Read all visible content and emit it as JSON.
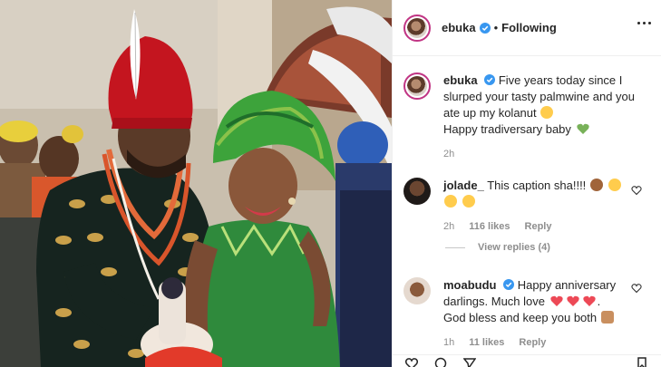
{
  "post": {
    "username": "ebuka",
    "follow_separator": "•",
    "follow_status": "Following"
  },
  "caption": {
    "username": "ebuka",
    "text_line1": "Five years today since I slurped your tasty palmwine and you ate up my kolanut",
    "text_line2": "Happy tradiversary baby",
    "time": "2h"
  },
  "comments": [
    {
      "username": "jolade_",
      "text": "This caption sha!!!!",
      "likes": "116 likes",
      "reply": "Reply",
      "time": "2h"
    },
    {
      "username": "moabudu",
      "text_line1": "Happy anniversary darlings. Much love",
      "text_line2": "God bless and keep you both",
      "likes": "11 likes",
      "reply": "Reply",
      "time": "1h"
    }
  ],
  "view_replies": "View replies (4)",
  "colors": {
    "verified": "#3897f0",
    "story_ring": "#c13584",
    "muted": "#8e8e8e",
    "heart_red": "#ed4956",
    "heart_green": "#78b159"
  },
  "icons": {
    "verified": "verified-badge-icon",
    "more": "more-options-icon",
    "like": "heart-outline-icon",
    "comment": "comment-icon",
    "share": "share-icon",
    "save": "bookmark-icon"
  }
}
